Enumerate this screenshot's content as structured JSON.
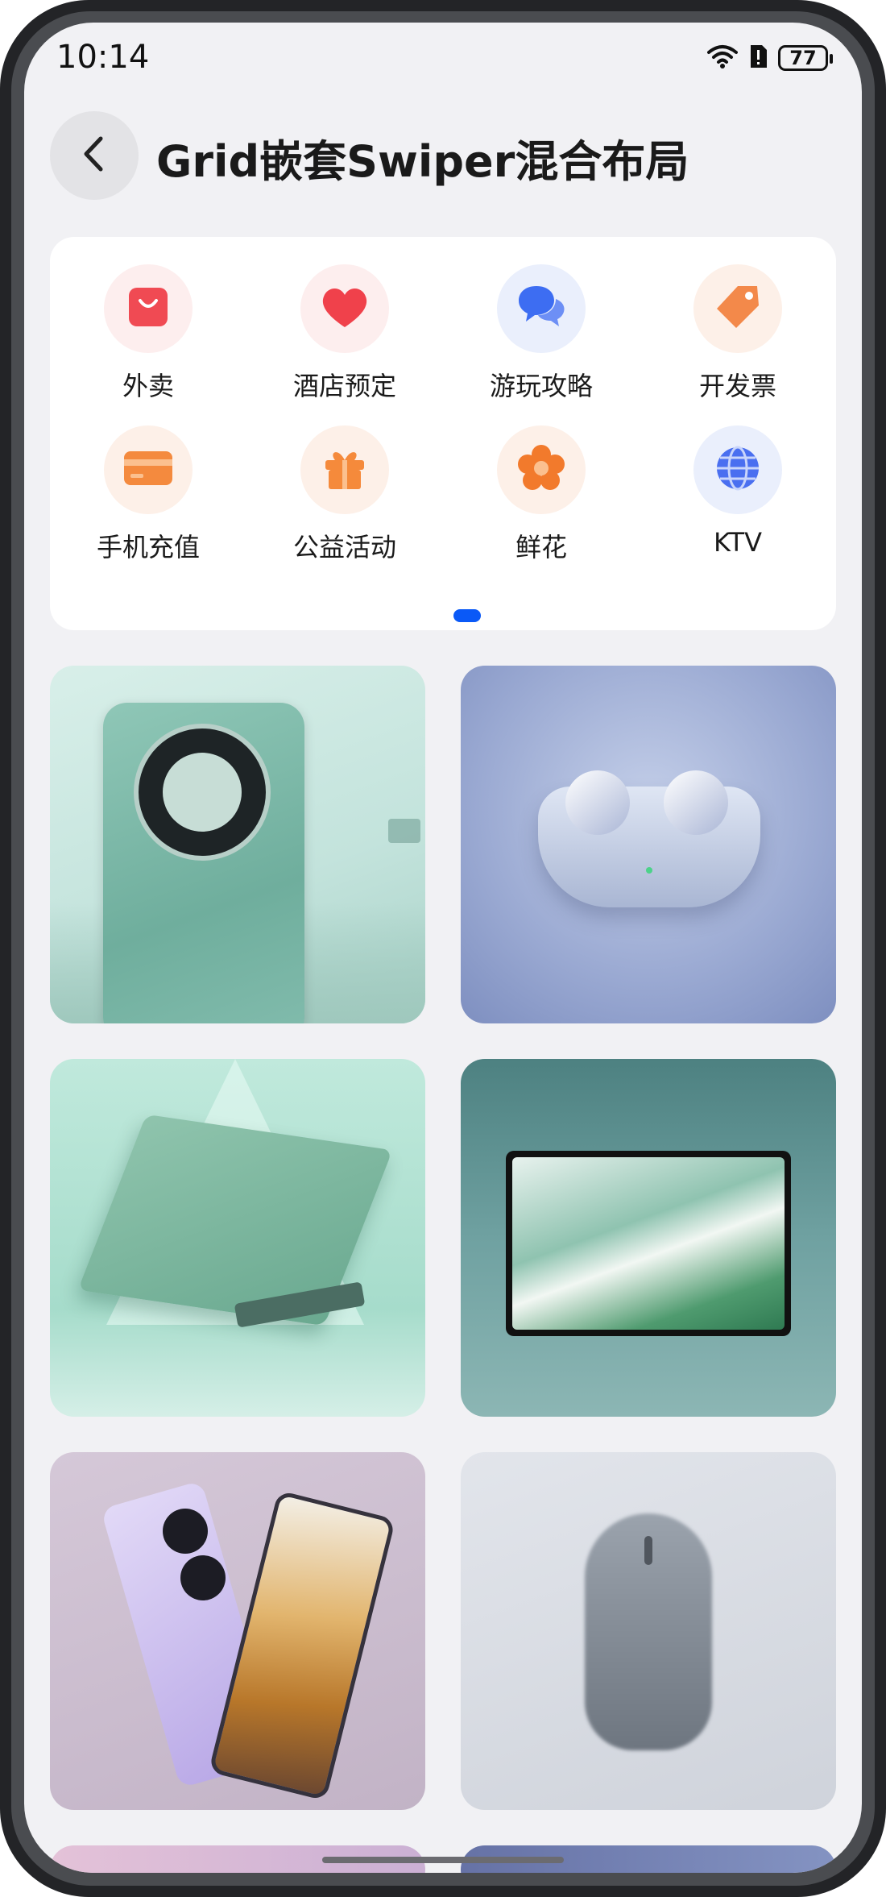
{
  "status": {
    "time": "10:14",
    "battery": "77"
  },
  "header": {
    "title": "Grid嵌套Swiper混合布局"
  },
  "categories": [
    {
      "label": "外卖",
      "icon": "shopping-bag-icon",
      "bg": "#fdeeee",
      "color": "#f04a53"
    },
    {
      "label": "酒店预定",
      "icon": "heart-icon",
      "bg": "#fdeeee",
      "color": "#f0414b"
    },
    {
      "label": "游玩攻略",
      "icon": "chat-bubbles-icon",
      "bg": "#eaeffc",
      "color": "#3d6df2"
    },
    {
      "label": "开发票",
      "icon": "price-tag-icon",
      "bg": "#fdf0e8",
      "color": "#f3894a"
    },
    {
      "label": "手机充值",
      "icon": "card-icon",
      "bg": "#fdf0e8",
      "color": "#f48a3e"
    },
    {
      "label": "公益活动",
      "icon": "gift-icon",
      "bg": "#fdf0e8",
      "color": "#f58a3b"
    },
    {
      "label": "鲜花",
      "icon": "flower-icon",
      "bg": "#fdf0e8",
      "color": "#f27a2c"
    },
    {
      "label": "KTV",
      "icon": "globe-icon",
      "bg": "#eaeffc",
      "color": "#4a6ff0"
    }
  ],
  "products": [
    {
      "name": "phone-mate-green",
      "bg": "#c9e6df"
    },
    {
      "name": "earbuds",
      "bg": "#99a8cf"
    },
    {
      "name": "laptop-green",
      "bg": "#b8e4d8"
    },
    {
      "name": "tablet",
      "bg": "#6e9ea0"
    },
    {
      "name": "foldable-phone",
      "bg": "#c7b8cc"
    },
    {
      "name": "mouse",
      "bg": "#d8dce3"
    }
  ]
}
